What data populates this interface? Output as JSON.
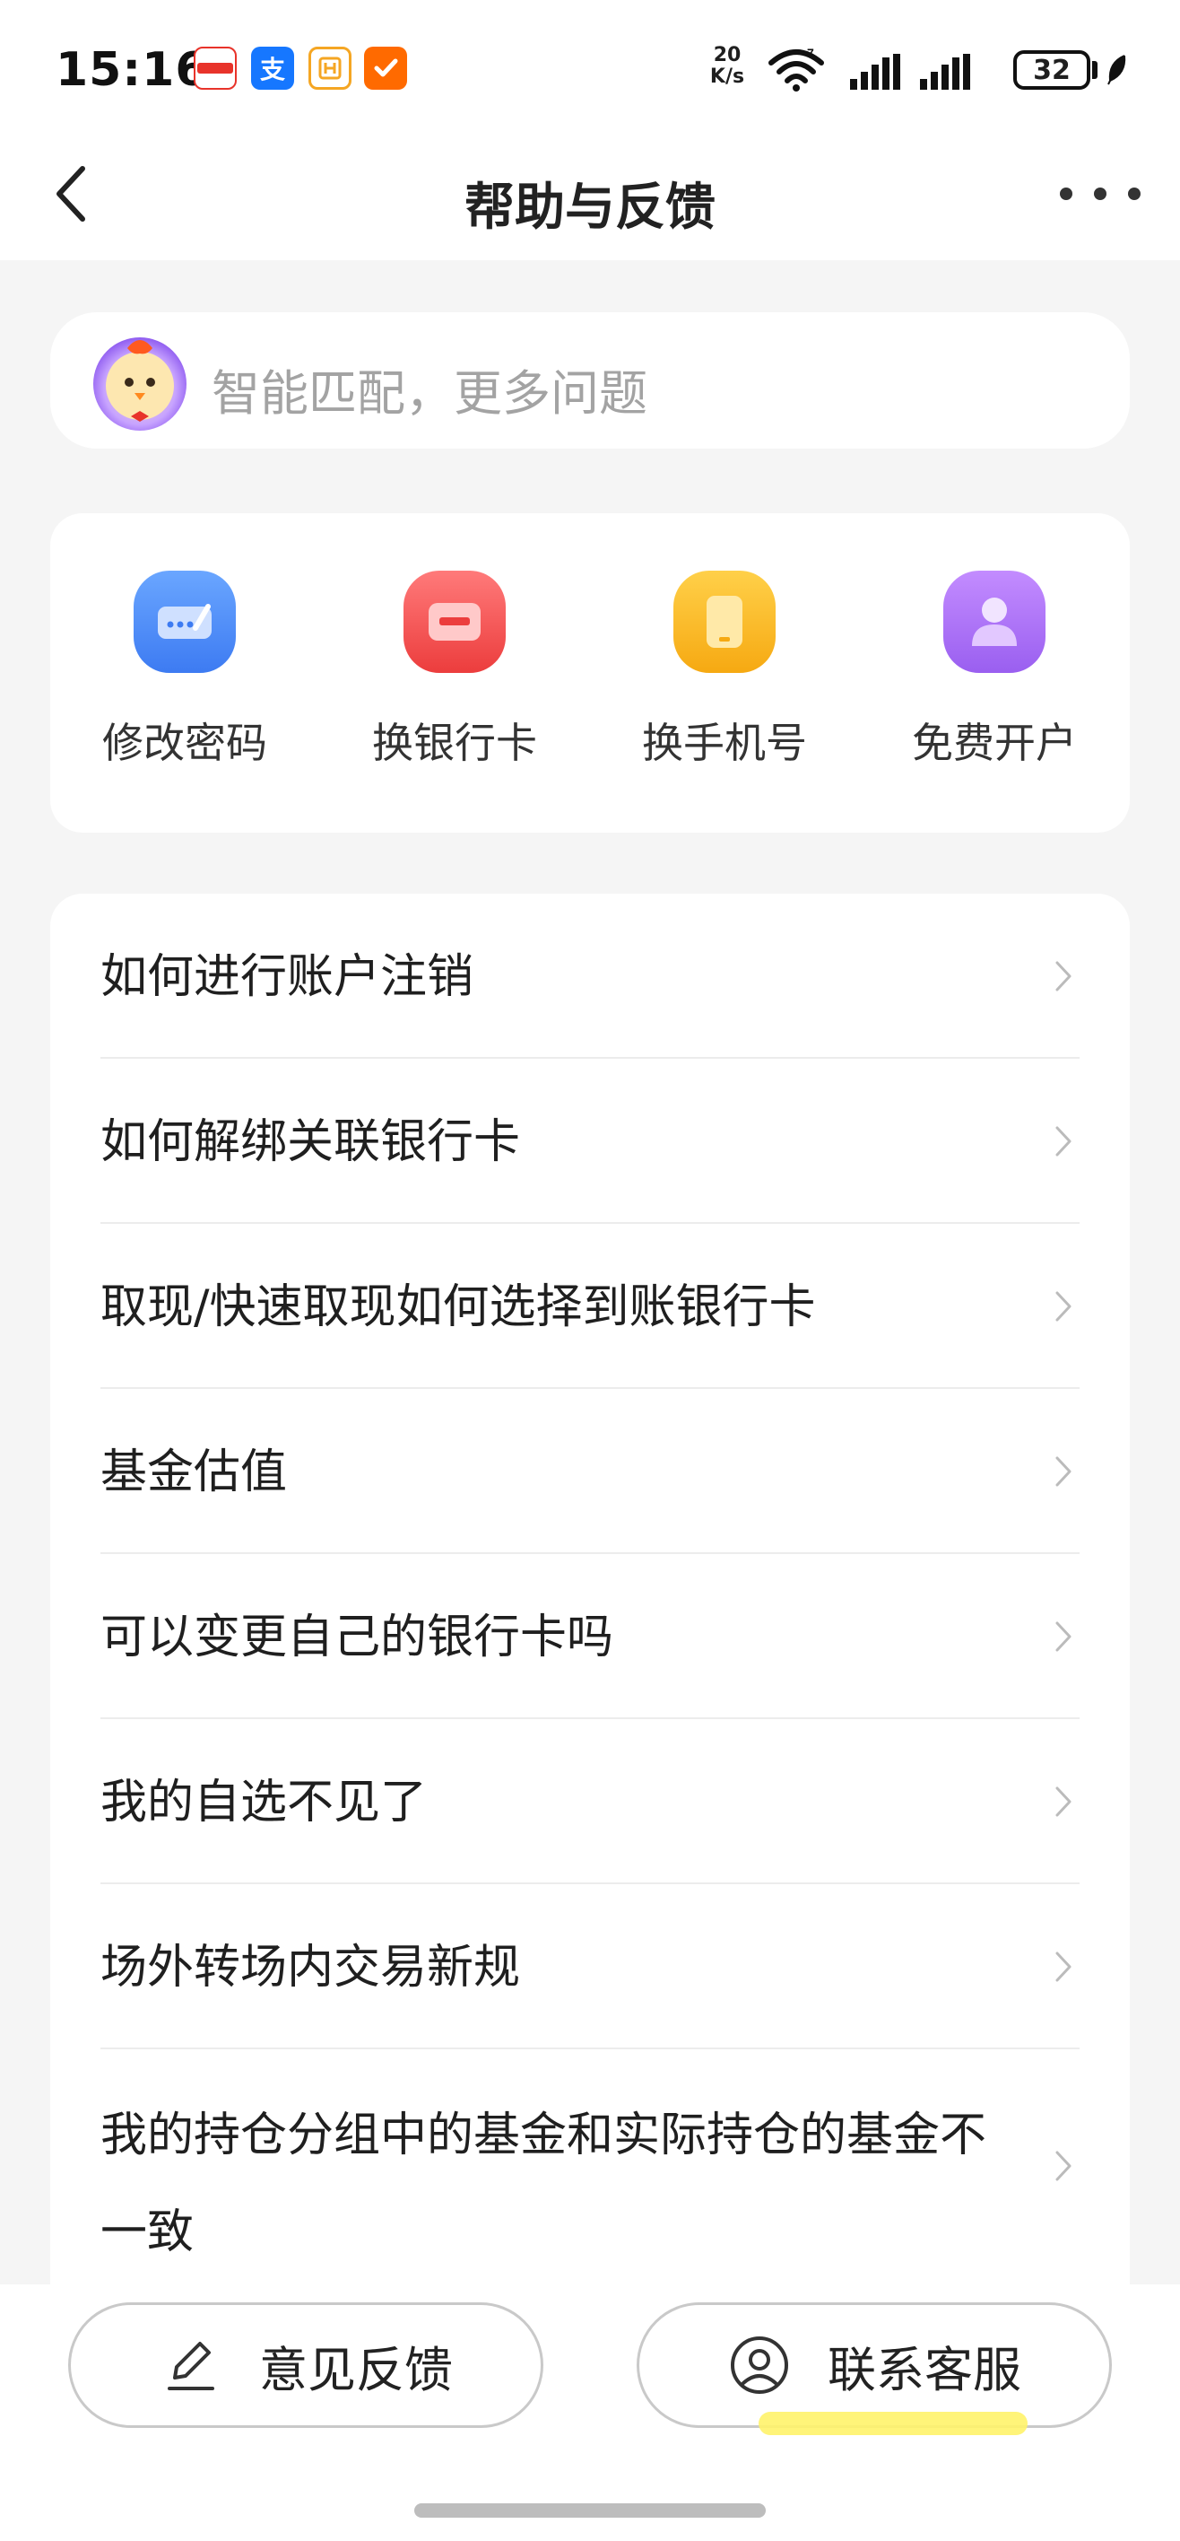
{
  "status_bar": {
    "time": "15:16",
    "net_speed_value": "20",
    "net_speed_unit": "K/s",
    "battery": "32",
    "app_icons": [
      {
        "name": "news-app-icon",
        "color": "#e8332a"
      },
      {
        "name": "alipay-app-icon",
        "color": "#1677ff",
        "glyph": "支"
      },
      {
        "name": "app-h-icon",
        "color": "#f5a623"
      },
      {
        "name": "task-check-app-icon",
        "color": "#ff6a00"
      }
    ]
  },
  "nav": {
    "title": "帮助与反馈"
  },
  "search": {
    "placeholder": "智能匹配，更多问题"
  },
  "quick_actions": [
    {
      "label": "修改密码",
      "icon": "password-edit-icon",
      "color": "#4e8ef7"
    },
    {
      "label": "换银行卡",
      "icon": "bank-card-icon",
      "color": "#f35353"
    },
    {
      "label": "换手机号",
      "icon": "phone-icon",
      "color": "#fbb423"
    },
    {
      "label": "免费开户",
      "icon": "user-account-icon",
      "color": "#a86ef0"
    }
  ],
  "faq": [
    {
      "text": "如何进行账户注销"
    },
    {
      "text": "如何解绑关联银行卡"
    },
    {
      "text": "取现/快速取现如何选择到账银行卡"
    },
    {
      "text": "基金估值"
    },
    {
      "text": "可以变更自己的银行卡吗"
    },
    {
      "text": "我的自选不见了"
    },
    {
      "text": "场外转场内交易新规"
    },
    {
      "text": "我的持仓分组中的基金和实际持仓的基金不一致"
    }
  ],
  "bottom": {
    "feedback_label": "意见反馈",
    "contact_label": "联系客服"
  }
}
